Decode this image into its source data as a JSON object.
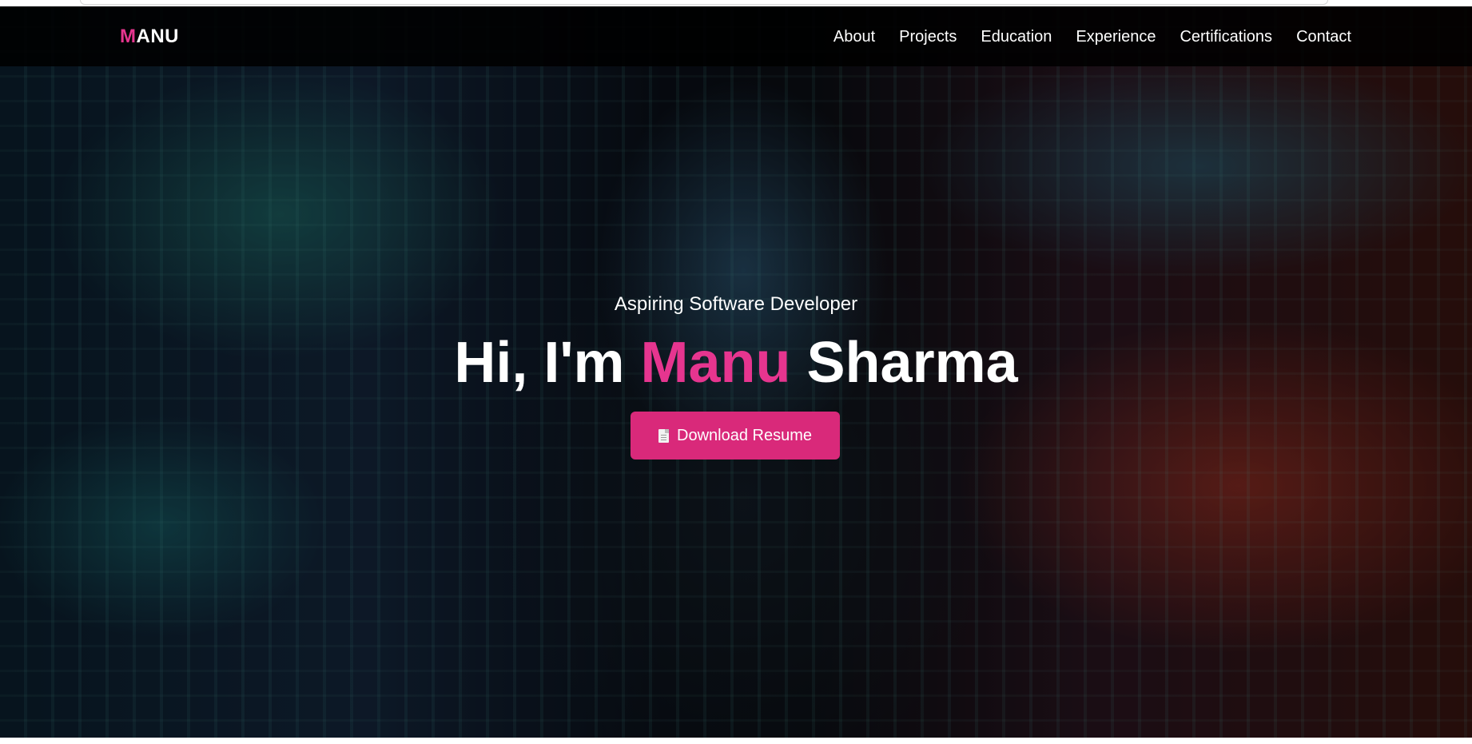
{
  "navbar": {
    "brand_first": "M",
    "brand_rest": "ANU",
    "links": [
      "About",
      "Projects",
      "Education",
      "Experience",
      "Certifications",
      "Contact"
    ]
  },
  "hero": {
    "tagline": "Aspiring Software Developer",
    "greeting": "Hi, I'm",
    "first_name": "Manu",
    "last_name": "Sharma",
    "cta_label": "Download Resume",
    "cta_icon": "document-icon"
  },
  "colors": {
    "accent": "#e6358f",
    "button": "#d9297a",
    "navbar": "#000000",
    "text": "#ffffff"
  }
}
